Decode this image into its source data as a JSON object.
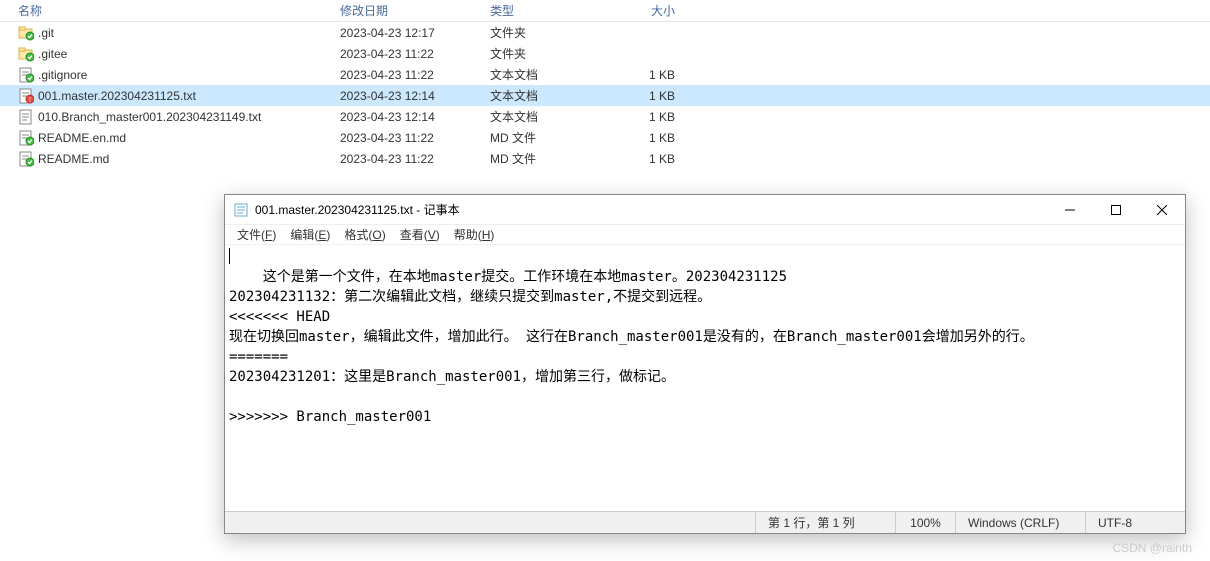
{
  "header": {
    "name": "名称",
    "date": "修改日期",
    "type": "类型",
    "size": "大小"
  },
  "files": [
    {
      "icon": "folder-green",
      "name": ".git",
      "date": "2023-04-23 12:17",
      "type": "文件夹",
      "size": "",
      "selected": false
    },
    {
      "icon": "folder-green",
      "name": ".gitee",
      "date": "2023-04-23 11:22",
      "type": "文件夹",
      "size": "",
      "selected": false
    },
    {
      "icon": "txt-green",
      "name": ".gitignore",
      "date": "2023-04-23 11:22",
      "type": "文本文档",
      "size": "1 KB",
      "selected": false
    },
    {
      "icon": "txt-red",
      "name": "001.master.202304231125.txt",
      "date": "2023-04-23 12:14",
      "type": "文本文档",
      "size": "1 KB",
      "selected": true
    },
    {
      "icon": "txt",
      "name": "010.Branch_master001.202304231149.txt",
      "date": "2023-04-23 12:14",
      "type": "文本文档",
      "size": "1 KB",
      "selected": false
    },
    {
      "icon": "txt-green",
      "name": "README.en.md",
      "date": "2023-04-23 11:22",
      "type": "MD 文件",
      "size": "1 KB",
      "selected": false
    },
    {
      "icon": "txt-green",
      "name": "README.md",
      "date": "2023-04-23 11:22",
      "type": "MD 文件",
      "size": "1 KB",
      "selected": false
    }
  ],
  "notepad": {
    "title": "001.master.202304231125.txt - 记事本",
    "menu": {
      "file": "文件(F)",
      "edit": "编辑(E)",
      "format": "格式(O)",
      "view": "查看(V)",
      "help": "帮助(H)"
    },
    "content": "这个是第一个文件，在本地master提交。工作环境在本地master。202304231125\n202304231132：第二次编辑此文档，继续只提交到master,不提交到远程。\n<<<<<<< HEAD\n现在切换回master，编辑此文件，增加此行。 这行在Branch_master001是没有的，在Branch_master001会增加另外的行。\n=======\n202304231201：这里是Branch_master001，增加第三行，做标记。\n\n>>>>>>> Branch_master001",
    "status": {
      "position": "第 1 行，第 1 列",
      "zoom": "100%",
      "eol": "Windows (CRLF)",
      "encoding": "UTF-8"
    }
  },
  "watermark": "CSDN @rainth"
}
